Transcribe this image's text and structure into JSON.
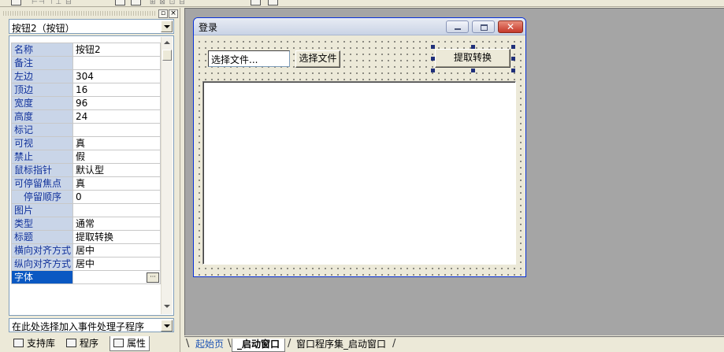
{
  "form": {
    "title": "登录",
    "file_input_value": "选择文件...",
    "choose_button_label": "选择文件",
    "convert_button_label": "提取转换",
    "close_glyph": "✕"
  },
  "property_panel": {
    "object_selector": "按钮2（按钮）",
    "rows": [
      {
        "key": "名称",
        "value": "按钮2"
      },
      {
        "key": "备注",
        "value": ""
      },
      {
        "key": "左边",
        "value": "304"
      },
      {
        "key": "顶边",
        "value": "16"
      },
      {
        "key": "宽度",
        "value": "96"
      },
      {
        "key": "高度",
        "value": "24"
      },
      {
        "key": "标记",
        "value": ""
      },
      {
        "key": "可视",
        "value": "真"
      },
      {
        "key": "禁止",
        "value": "假"
      },
      {
        "key": "鼠标指针",
        "value": "默认型"
      },
      {
        "key": "可停留焦点",
        "value": "真"
      },
      {
        "key": "停留顺序",
        "value": "0"
      },
      {
        "key": "图片",
        "value": ""
      },
      {
        "key": "类型",
        "value": "通常"
      },
      {
        "key": "标题",
        "value": "提取转换"
      },
      {
        "key": "横向对齐方式",
        "value": "居中"
      },
      {
        "key": "纵向对齐方式",
        "value": "居中"
      },
      {
        "key": "字体",
        "value": ""
      }
    ],
    "event_selector": "在此处选择加入事件处理子程序",
    "ellipsis": "···",
    "tabs": [
      {
        "label": "支持库",
        "icon": "library-icon"
      },
      {
        "label": "程序",
        "icon": "program-icon"
      },
      {
        "label": "属性",
        "icon": "properties-icon"
      }
    ]
  },
  "editor_tabs": [
    {
      "label": "起始页"
    },
    {
      "label": "_启动窗口"
    },
    {
      "label": "窗口程序集_启动窗口"
    }
  ],
  "colors": {
    "workspace": "#a5a5a5",
    "property_key_bg": "#c9d5e8",
    "selected_row": "#0a58c2",
    "close_button": "#c5392a"
  }
}
